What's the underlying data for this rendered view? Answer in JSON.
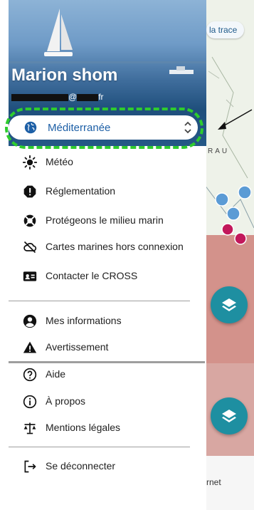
{
  "map": {
    "trace_chip": "la trace",
    "coast_label": "RAU",
    "bottom_tab_label": "rnet"
  },
  "header": {
    "user_name": "Marion shom",
    "email_domain_suffix": "fr",
    "email_at": "@"
  },
  "zone_selector": {
    "label": "Méditerranée",
    "accent_color": "#1d5fa6",
    "highlight_color": "#2ecc2e"
  },
  "menu": {
    "section1": [
      {
        "label": "Météo",
        "icon": "sun-icon"
      },
      {
        "label": "Réglementation",
        "icon": "alert-octagon-icon"
      },
      {
        "label": "Protégeons le milieu marin",
        "icon": "lifebuoy-icon"
      },
      {
        "label": "Cartes marines hors connexion",
        "icon": "cloud-off-icon"
      },
      {
        "label": "Contacter le CROSS",
        "icon": "contact-card-icon"
      }
    ],
    "section2": [
      {
        "label": "Mes informations",
        "icon": "account-circle-icon"
      },
      {
        "label": "Avertissement",
        "icon": "warning-triangle-icon"
      },
      {
        "label": "Aide",
        "icon": "help-circle-icon"
      },
      {
        "label": "À propos",
        "icon": "info-circle-icon"
      },
      {
        "label": "Mentions légales",
        "icon": "scale-icon"
      }
    ],
    "logout": {
      "label": "Se déconnecter",
      "icon": "logout-icon"
    }
  }
}
